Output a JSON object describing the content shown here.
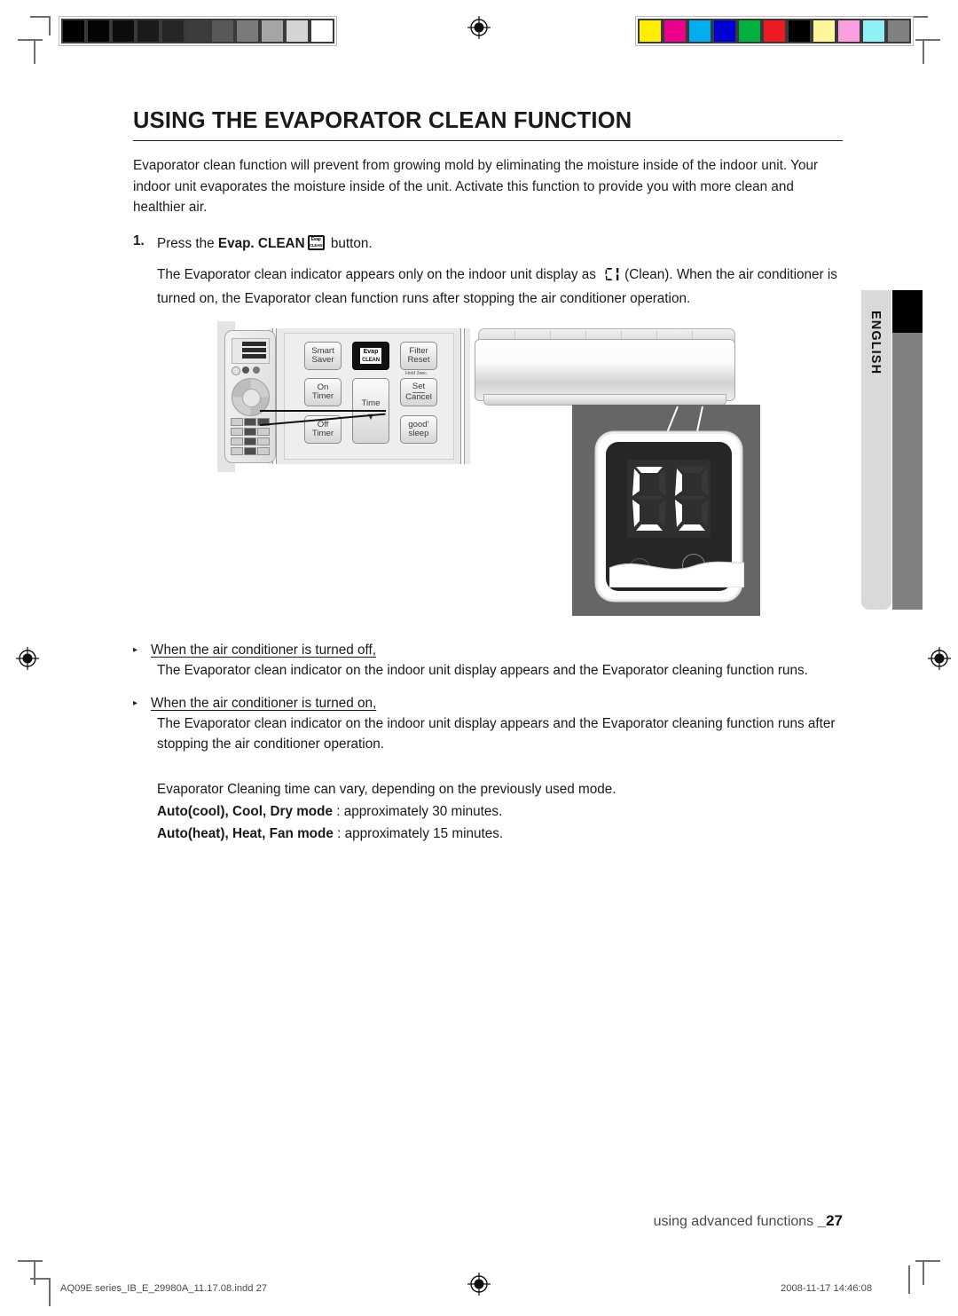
{
  "document": {
    "title": "USING THE EVAPORATOR CLEAN FUNCTION",
    "intro": "Evaporator clean function will prevent from growing mold by eliminating the moisture inside of the indoor unit. Your indoor unit evaporates the moisture inside of the unit. Activate this function to provide you with more clean and healthier air.",
    "step": {
      "number": "1.",
      "text_before": "Press the ",
      "bold_label": "Evap. CLEAN",
      "text_after": " button.",
      "detail_line1_before": "The Evaporator clean indicator appears only on the indoor unit display as ",
      "detail_line1_after": "(Clean).",
      "detail_rest": "When the air conditioner is turned on, the Evaporator clean function runs after stopping the air conditioner operation."
    },
    "bullets": [
      {
        "title": "When the air conditioner is turned off,",
        "text": "The Evaporator clean indicator on the indoor unit display appears and the Evaporator cleaning function runs."
      },
      {
        "title": "When the air conditioner is turned on,",
        "text": "The Evaporator clean indicator on the indoor unit display appears and the Evaporator cleaning function runs after stopping the air conditioner operation."
      }
    ],
    "tail": {
      "note": "Evaporator Cleaning time can vary, depending on the previously used mode.",
      "mode1_label": "Auto(cool), Cool, Dry mode",
      "mode1_value": " : approximately 30 minutes.",
      "mode2_label": "Auto(heat), Heat, Fan mode",
      "mode2_value": " : approximately 15 minutes."
    },
    "side_tab": "ENGLISH",
    "footer": {
      "text": "using advanced functions ",
      "page": "_27"
    },
    "imprint": {
      "file": "AQ09E series_IB_E_29980A_11.17.08.indd   27",
      "timestamp": "2008-11-17   14:46:08"
    }
  },
  "remote_illustration": {
    "buttons": [
      {
        "name": "smart-saver",
        "line1": "Smart",
        "line2": "Saver"
      },
      {
        "name": "evap-clean",
        "line1": "Evap",
        "line2": "CLEAN"
      },
      {
        "name": "filter-reset",
        "line1": "Filter",
        "line2": "Reset"
      },
      {
        "name": "on-timer",
        "line1": "On",
        "line2": "Timer"
      },
      {
        "name": "time",
        "line1": "Time",
        "line2": "▼"
      },
      {
        "name": "set-cancel",
        "line1": "Set",
        "line2": "Cancel"
      },
      {
        "name": "off-timer",
        "line1": "Off",
        "line2": "Timer"
      },
      {
        "name": "good-sleep",
        "line1": "good’",
        "line2": "sleep"
      }
    ],
    "hold_note": "Hold 3sec."
  },
  "display_illustration": {
    "segment_text": "CL",
    "description": "indoor unit display showing evaporator clean indicator"
  },
  "print_marks": {
    "grayscale": [
      "#000000",
      "#050505",
      "#0d0d0d",
      "#1a1a1a",
      "#262626",
      "#3d3d3d",
      "#595959",
      "#7a7a7a",
      "#a6a6a6",
      "#d4d4d4",
      "#ffffff"
    ],
    "colorbar": [
      "#ffed00",
      "#ec008c",
      "#00aeef",
      "#0000d4",
      "#00b140",
      "#ed1c24",
      "#000000",
      "#fff79a",
      "#f99fe0",
      "#8ff0f6",
      "#808080"
    ]
  }
}
